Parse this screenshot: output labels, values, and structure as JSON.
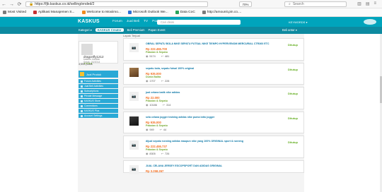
{
  "browser": {
    "url": "https://fjb.kaskus.co.id/selling/ended/2",
    "zoom": "70%",
    "search_placeholder": "Search",
    "bookmarks": [
      "Most Visited",
      "Aplikasi Manajemen S...",
      "Welcome to Moxiimo...",
      "Microsoft Outlook We...",
      "Data CoC",
      "http://amounit.pin.co...."
    ]
  },
  "header": {
    "logo": "KASKUS",
    "links": [
      "Forum",
      "Jual Beli",
      "TV",
      "Podcast"
    ],
    "search_placeholder": "Cari disini",
    "keyword_label": "KEYWORDS ▾"
  },
  "subbar": {
    "category": "Kategori ▾",
    "active": "KASKUS Creator",
    "items": [
      "Beli Premium",
      "Papan Event"
    ],
    "right": "Beli antar ▾"
  },
  "profile": {
    "username": "dragonfly1212",
    "meta": [
      "kaskus maniac",
      "Sejak: 03/2014"
    ],
    "stars": "★★★★",
    "posts": "4,555 posts"
  },
  "sidebar": {
    "new_thread": "Jual Produk",
    "menu": [
      "Forum Activities",
      "Jual Beli Activities",
      "Subscriptions",
      "Private Message",
      "KASKUS Store",
      "Connections",
      "KASKUS Plus",
      "Account Settings"
    ]
  },
  "listing": {
    "heading": "Lapak Terjual",
    "items": [
      {
        "title": "OBRAL SEPATU BOLA NIKE SEPATU FUTSAL NIKE TIEMPO HYPERVENOM MERCURIAL CTR360 ETC",
        "price": "Rp 222.455.700",
        "category": "Pakaian & Sepatu",
        "views": "5174",
        "replies": "481",
        "status": "Ditutup",
        "thumb": "placeholder"
      },
      {
        "title": "sepatu bola, sepatu futsal 100% original",
        "price": "Rp 935.000",
        "category": "Dunia Balita",
        "views": "1707",
        "replies": "228",
        "status": "Ditutup",
        "thumb": "photo"
      },
      {
        "title": "jual celana batik nike adidas",
        "price": "Rp 22.000",
        "category": "Pakaian & Sepatu",
        "views": "10186",
        "replies": "314",
        "status": "Ditutup",
        "thumb": "placeholder"
      },
      {
        "title": "sela celana jogger training adidas nike puma lotto jogger",
        "price": "Rp 935.000",
        "category": "Pakaian & Sepatu",
        "views": "949",
        "replies": "44",
        "status": "Ditutup",
        "thumb": "photo-dark"
      },
      {
        "title": "dijual sepatu running adidas maupun nike yang 100% ORIGINAL sport & running",
        "price": "Rp 222.455.737",
        "category": "Pakaian & Sepatu",
        "views": "8305",
        "replies": "726",
        "status": "Ditutup",
        "thumb": "placeholder"
      },
      {
        "title": "JUAL CELANA JERSEY ESCOPSPORT DAN ADIDAS ORIGINAL",
        "price": "Rp 3.258.267",
        "category": "",
        "views": "",
        "replies": "",
        "status": "",
        "thumb": "placeholder"
      }
    ]
  },
  "colors": {
    "brand": "#00a4bc",
    "link": "#0d78a7",
    "price": "#f36f21",
    "status": "#62ad1e"
  }
}
